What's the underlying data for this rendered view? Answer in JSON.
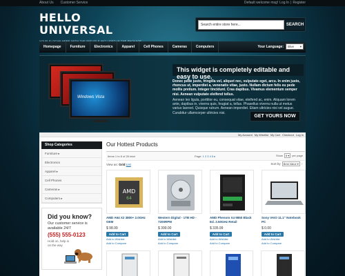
{
  "topbar": {
    "links": [
      "About Us",
      "Customer Service"
    ],
    "welcome": "Default welcome msg!",
    "login": "Log In",
    "separator": "|",
    "register": "Register"
  },
  "header": {
    "logo_text": "HELLO UNIVERSAL",
    "slogan": "YOUR SLOGAN HERE WITH THE PSD FILE INCLUDED IN THE PACKAGE",
    "search_placeholder": "Search entire store here...",
    "search_button": "SEARCH"
  },
  "nav": {
    "items": [
      "Homepage",
      "Furniture",
      "Electronics",
      "Apparel",
      "Cell Phones",
      "Cameras",
      "Computers"
    ],
    "language_label": "Your Language:",
    "language_value": "Blue"
  },
  "banner": {
    "screen_logo": "Windows Vista",
    "heading": "This widget is completely editable and easy to use.",
    "para1": "Donec pede justo, fringilla vel, aliquet nec, vulputate eget, arcu. In enim justo, rhoncus ut, imperdiet a, venenatis vitae, justo. Nullam dictum felis eu pede mollis pretium. Integer tincidunt. Cras dapibus. Vivamus elementum semper nisi. Aenean vulputate eleifend tellus.",
    "para2": "Aenean leo ligula, porttitor eu, consequat vitae, eleifend ac, enim. Aliquam lorem ante, dapibus in, viverra quis, feugiat a, tellus. Phasellus viverra nulla ut metus varius laoreet. Quisque rutrum. Aenean imperdiet. Etiam ultricies nisi vel augue. Curabitur ullamcorper ultricies nisi.",
    "cta": "GET YOURS NOW"
  },
  "account_links": [
    "My Account",
    "My Wishlist",
    "My Cart",
    "Checkout",
    "Log In"
  ],
  "sidebar": {
    "title": "Shop Categories",
    "items": [
      "Furniture ▸",
      "Electronics",
      "Apparel ▸",
      "Cell Phones",
      "Cameras ▸",
      "Computers ▸"
    ],
    "dyk_title": "Did you know?",
    "dyk_text": "Our customer service is available 24/7",
    "dyk_phone": "(555) 555-0123",
    "dyk_note": "Hold on, help is on the way"
  },
  "main": {
    "title": "Our Hottest Products",
    "items_label": "Items 1 to 8 of 28 total",
    "page_label": "Page:",
    "pages": [
      "1",
      "2",
      "3",
      "4",
      "5",
      "▸"
    ],
    "show_label": "Show",
    "show_value": "8",
    "per_page": "per page",
    "view_label": "View as:",
    "view_grid": "Grid",
    "view_list": "List",
    "sort_label": "Sort by",
    "sort_value": "Best Value",
    "add_to_cart": "Add to Cart",
    "add_to_wishlist": "Add to Wishlist",
    "add_to_compare": "Add to Compare",
    "products": [
      {
        "name": "AMD A64 X2 3800+ 2.0GHz OEM",
        "price": "$ 98.99",
        "image": "cpu-chip"
      },
      {
        "name": "Western Digital - 1TB HD - 7200RPM",
        "price": "$ 399.00",
        "image": "hard-drive"
      },
      {
        "name": "AMD Phenom X4 9850 Black Ed. 2.50GHz Retail",
        "price": "$ 335.99",
        "image": "cpu-box"
      },
      {
        "name": "Sony VAIO 11.1\" Notebook PC",
        "price": "$ 0.00",
        "image": "laptop"
      }
    ]
  }
}
